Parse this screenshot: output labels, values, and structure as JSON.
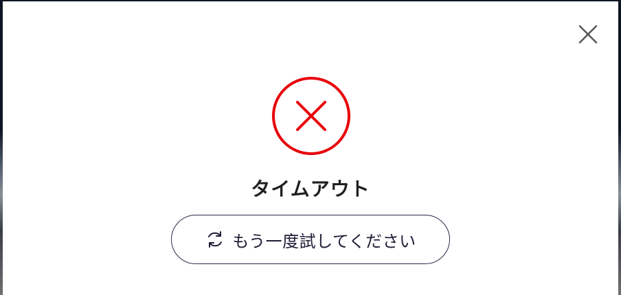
{
  "dialog": {
    "close_icon": "close-icon",
    "status_icon": "error-circle-x-icon",
    "title": "タイムアウト",
    "retry_button": {
      "icon": "refresh-icon",
      "label": "もう一度試してください"
    }
  },
  "colors": {
    "error": "#e8000b",
    "text": "#1f1f1f",
    "button_border": "#2b2a4a",
    "close_icon": "#555555"
  }
}
